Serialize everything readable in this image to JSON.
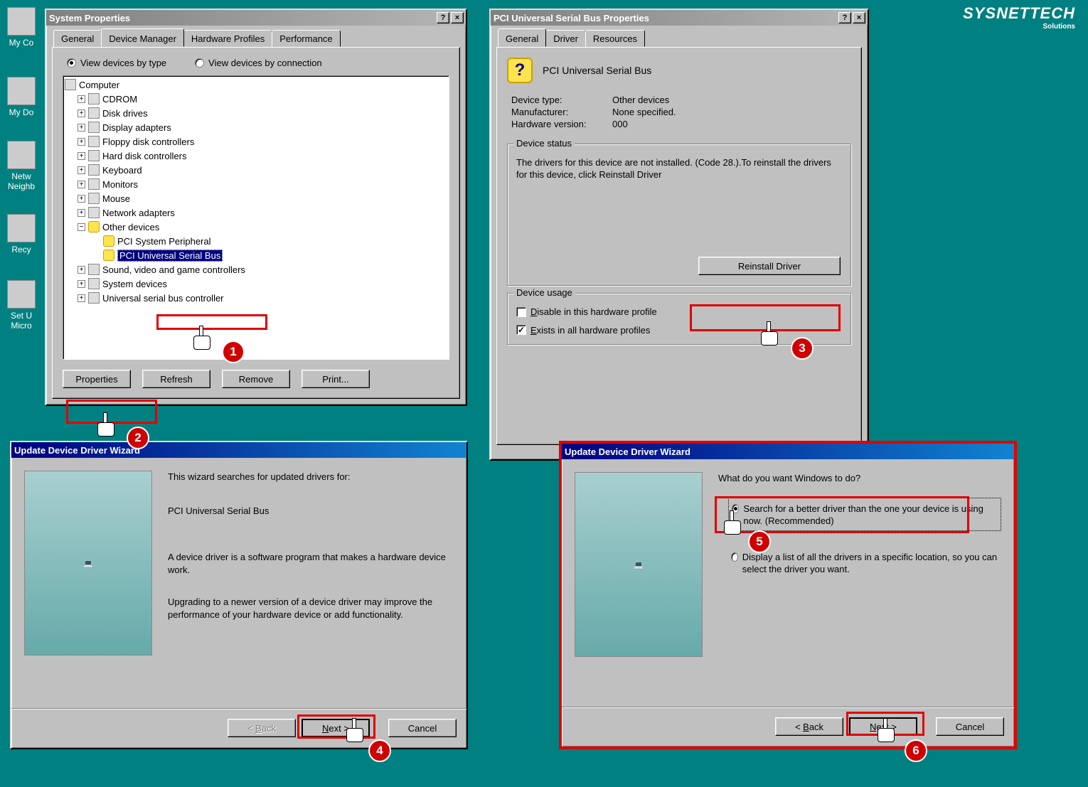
{
  "logo": {
    "brand": "SYSNETTECH",
    "sub": "Solutions"
  },
  "desktop": {
    "icons": [
      "My Co",
      "My Do",
      "Netw\nNeighb",
      "Recy",
      "Set U\nMicro",
      ""
    ]
  },
  "sysprop": {
    "title": "System Properties",
    "tabs": [
      "General",
      "Device Manager",
      "Hardware Profiles",
      "Performance"
    ],
    "active_tab": 1,
    "view_radios": {
      "by_type": "View devices by type",
      "by_conn": "View devices by connection"
    },
    "tree_root": "Computer",
    "tree": [
      {
        "exp": "+",
        "label": "CDROM"
      },
      {
        "exp": "+",
        "label": "Disk drives"
      },
      {
        "exp": "+",
        "label": "Display adapters"
      },
      {
        "exp": "+",
        "label": "Floppy disk controllers"
      },
      {
        "exp": "+",
        "label": "Hard disk controllers"
      },
      {
        "exp": "+",
        "label": "Keyboard"
      },
      {
        "exp": "+",
        "label": "Monitors"
      },
      {
        "exp": "+",
        "label": "Mouse"
      },
      {
        "exp": "+",
        "label": "Network adapters"
      },
      {
        "exp": "-",
        "label": "Other devices",
        "warn": true,
        "children": [
          {
            "label": "PCI System Peripheral",
            "warn": true
          },
          {
            "label": "PCI Universal Serial Bus",
            "warn": true,
            "selected": true
          }
        ]
      },
      {
        "exp": "+",
        "label": "Sound, video and game controllers"
      },
      {
        "exp": "+",
        "label": "System devices"
      },
      {
        "exp": "+",
        "label": "Universal serial bus controller"
      }
    ],
    "buttons": {
      "properties": "Properties",
      "refresh": "Refresh",
      "remove": "Remove",
      "print": "Print..."
    }
  },
  "usbprop": {
    "title": "PCI Universal Serial Bus Properties",
    "tabs": [
      "General",
      "Driver",
      "Resources"
    ],
    "active_tab": 0,
    "header_name": "PCI Universal Serial Bus",
    "fields": {
      "device_type_label": "Device type:",
      "device_type": "Other devices",
      "manufacturer_label": "Manufacturer:",
      "manufacturer": "None specified.",
      "hw_version_label": "Hardware version:",
      "hw_version": "000"
    },
    "status_group_label": "Device status",
    "status_text": "The drivers for this device are not installed. (Code 28.).To reinstall the drivers for this device, click Reinstall Driver",
    "reinstall_btn": "Reinstall Driver",
    "usage_group_label": "Device usage",
    "disable_check": "Disable in this hardware profile",
    "exists_check": "Exists in all hardware profiles"
  },
  "wiz1": {
    "title": "Update Device Driver Wizard",
    "line1": "This wizard searches for updated drivers for:",
    "device": "PCI Universal Serial Bus",
    "line2": "A device driver is a software program that makes a hardware device work.",
    "line3": "Upgrading to a newer version of a device driver may improve the performance of your hardware device or add functionality.",
    "buttons": {
      "back": "< Back",
      "next": "Next >",
      "cancel": "Cancel"
    }
  },
  "wiz2": {
    "title": "Update Device Driver Wizard",
    "question": "What do you want Windows to do?",
    "opt1": "Search for a better driver than the one your device is using now. (Recommended)",
    "opt2": "Display a list of all the drivers in a specific location, so you can select the driver you want.",
    "buttons": {
      "back": "< Back",
      "next": "Next >",
      "cancel": "Cancel"
    }
  },
  "steps": {
    "s1": "1",
    "s2": "2",
    "s3": "3",
    "s4": "4",
    "s5": "5",
    "s6": "6"
  }
}
